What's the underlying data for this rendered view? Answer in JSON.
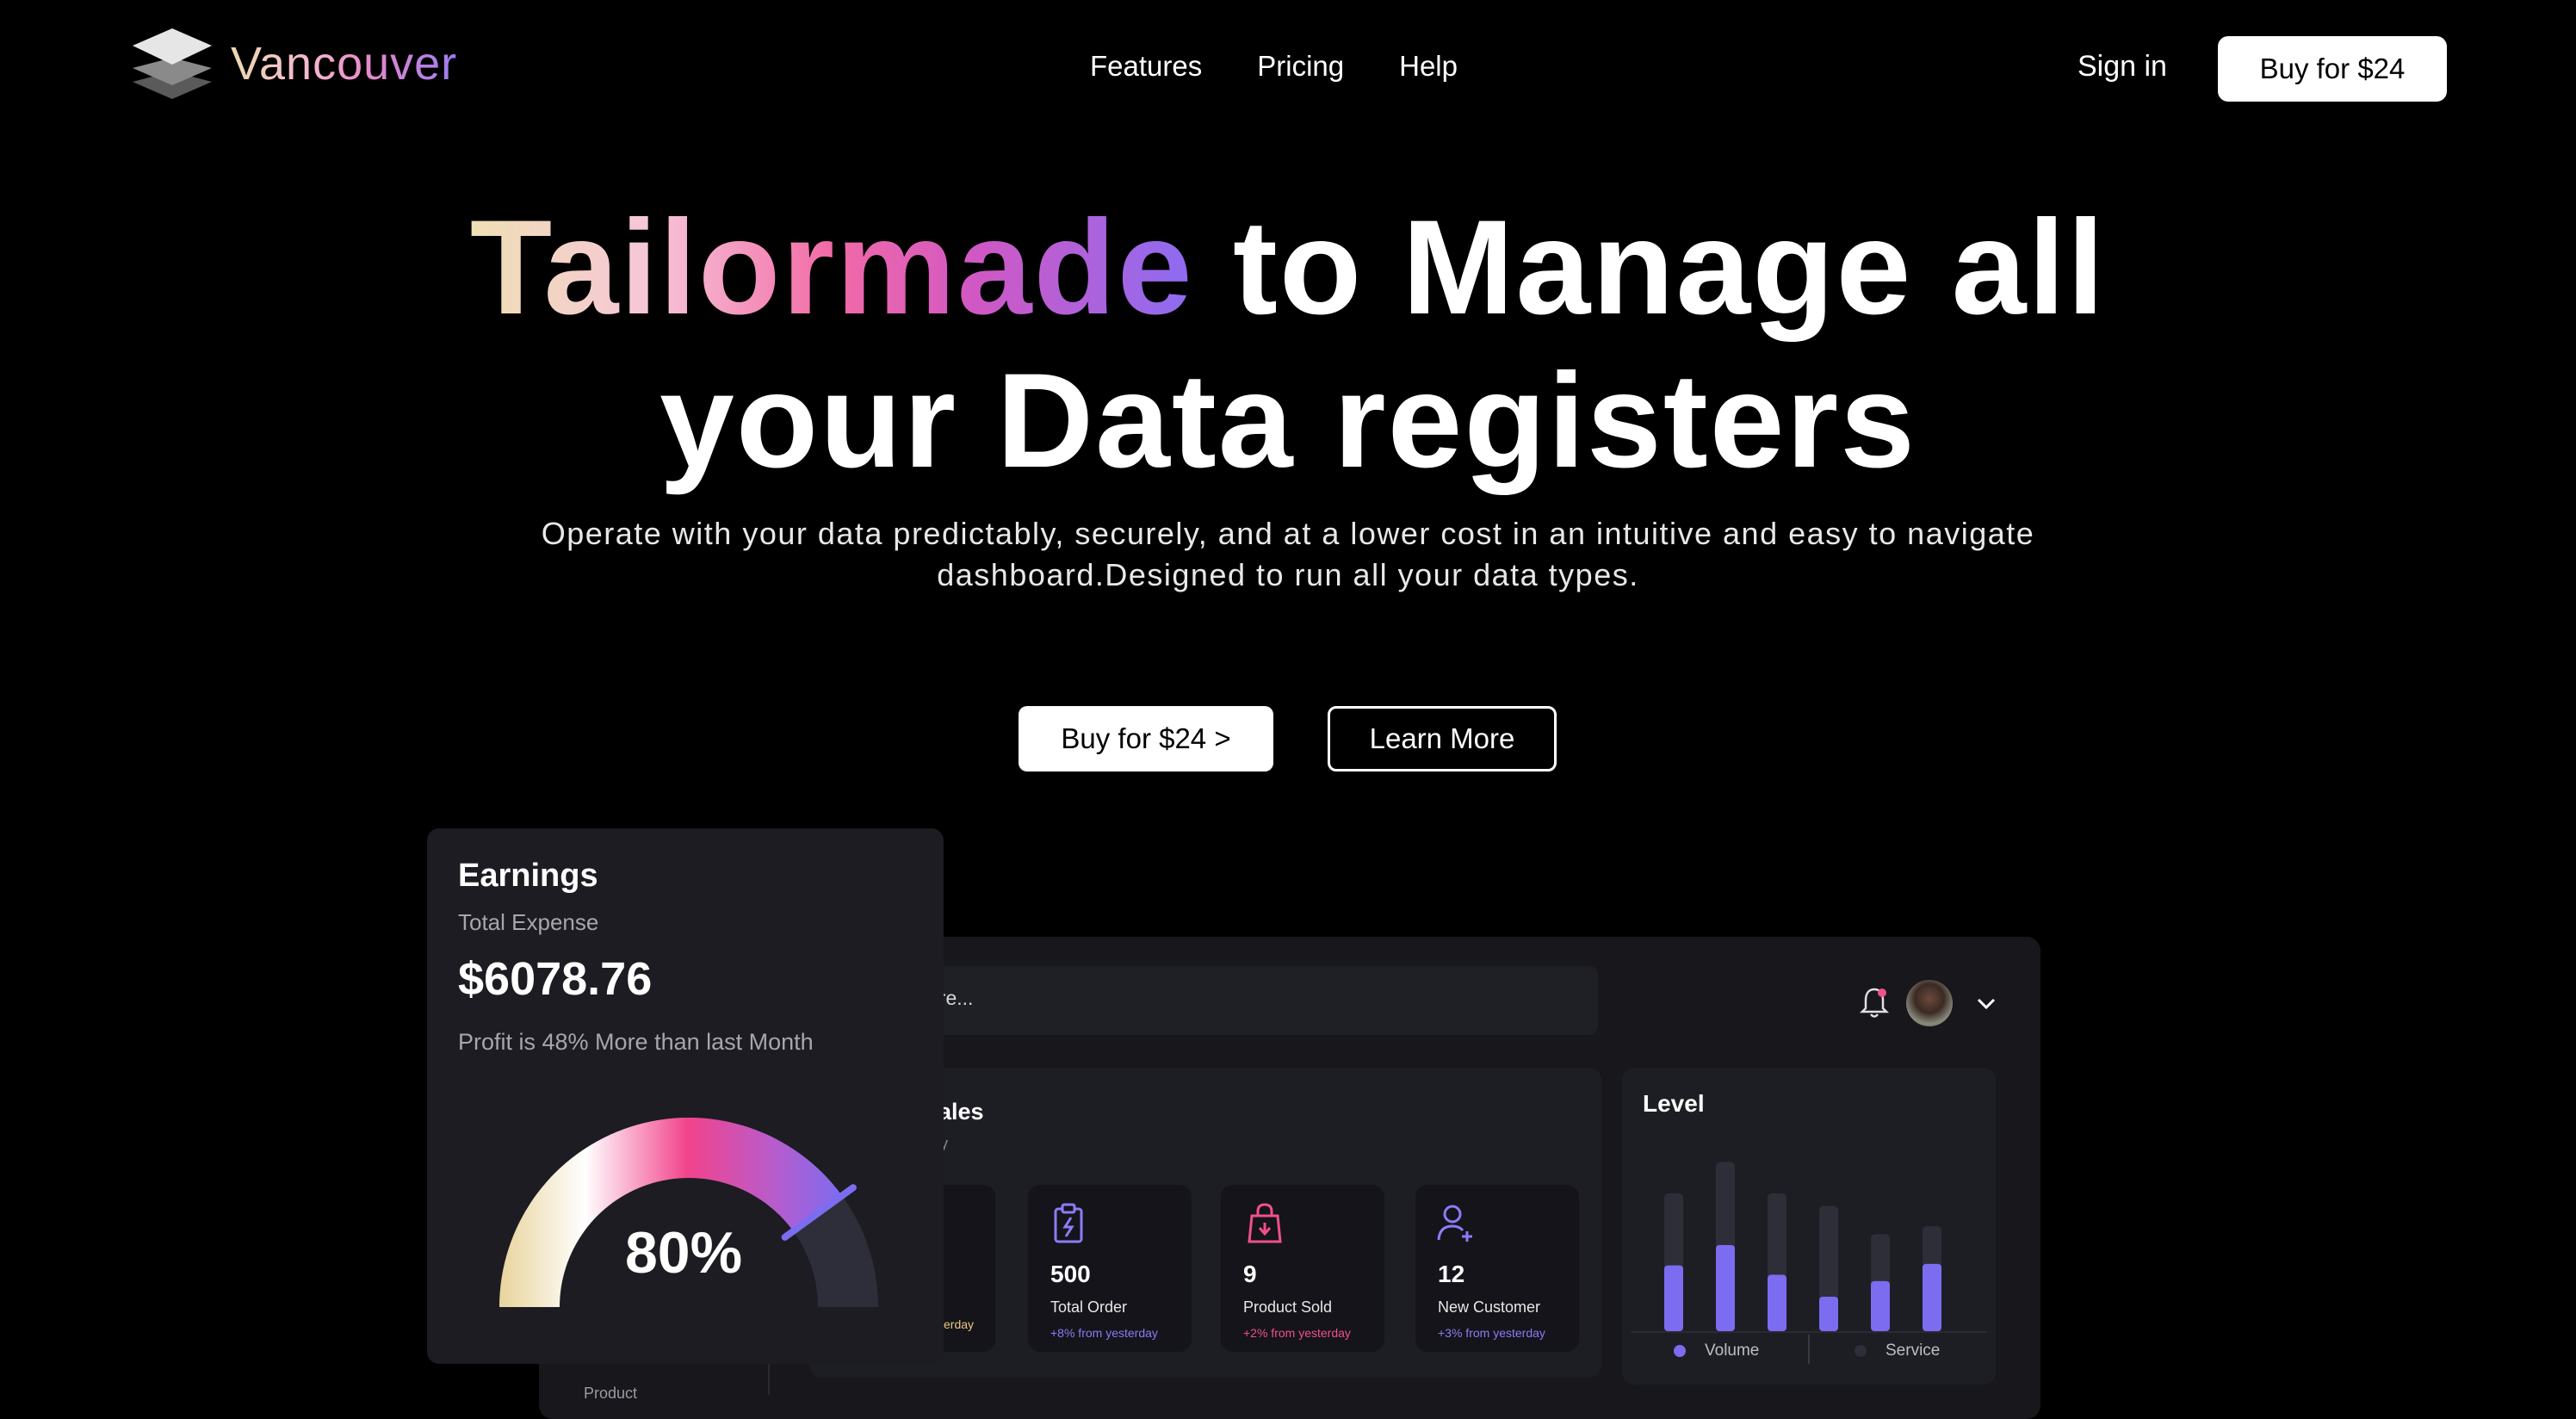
{
  "brand": {
    "name": "Vancouver"
  },
  "nav": {
    "links": [
      "Features",
      "Pricing",
      "Help"
    ],
    "sign_in": "Sign in",
    "buy": "Buy for $24"
  },
  "hero": {
    "title_highlight": "Tailormade",
    "title_rest_line1": "to Manage all",
    "title_line2": "your Data registers",
    "subtitle_line1": "Operate with your data predictably, securely, and at a lower cost in an intuitive and easy to navigate",
    "subtitle_line2": "dashboard.Designed to run all your data types.",
    "buy_button": "Buy for $24 >",
    "learn_button": "Learn More"
  },
  "dashboard": {
    "search_placeholder": "ere...",
    "sales": {
      "title": "ales",
      "subtitle": "y",
      "cut_change": "erday",
      "stats": [
        {
          "icon": "clipboard-bolt-icon",
          "value": "500",
          "label": "Total Order",
          "change": "+8% from yesterday",
          "color": "#8b7cf6"
        },
        {
          "icon": "shopping-bag-icon",
          "value": "9",
          "label": "Product Sold",
          "change": "+2% from yesterday",
          "color": "#f0508c"
        },
        {
          "icon": "add-user-icon",
          "value": "12",
          "label": "New Customer",
          "change": "+3% from yesterday",
          "color": "#8b7cf6"
        }
      ]
    },
    "level": {
      "title": "Level",
      "legend": [
        "Volume",
        "Service"
      ]
    },
    "sidebar_fragment": "Product"
  },
  "chart_data": {
    "type": "bar",
    "title": "Level",
    "series": [
      {
        "name": "Volume",
        "values": [
          42,
          55,
          36,
          22,
          32,
          43
        ],
        "color": "#7c6cf0"
      },
      {
        "name": "Service",
        "values": [
          88,
          108,
          88,
          80,
          62,
          67
        ],
        "color": "#2e2e38"
      }
    ],
    "ylim": [
      0,
      110
    ],
    "grid": false,
    "legend": "bottom"
  },
  "earnings": {
    "title": "Earnings",
    "subtitle": "Total Expense",
    "value": "$6078.76",
    "note": "Profit is 48% More than last Month",
    "gauge_percent": "80%",
    "gauge_fraction": 0.8
  }
}
